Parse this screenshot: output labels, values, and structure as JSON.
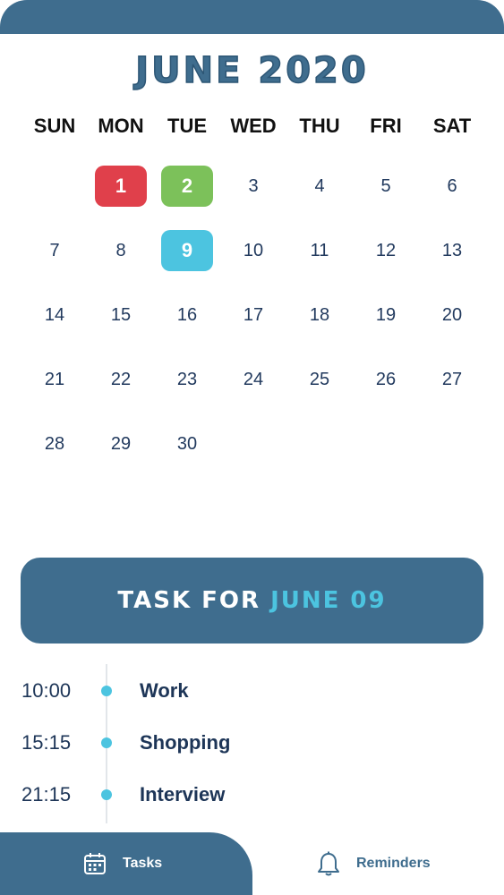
{
  "calendar": {
    "month_title": "JUNE 2020",
    "weekdays": [
      "SUN",
      "MON",
      "TUE",
      "WED",
      "THU",
      "FRI",
      "SAT"
    ],
    "days": [
      {
        "n": "1",
        "col": 1,
        "row": 0,
        "style": "red"
      },
      {
        "n": "2",
        "col": 2,
        "row": 0,
        "style": "green"
      },
      {
        "n": "3",
        "col": 3,
        "row": 0
      },
      {
        "n": "4",
        "col": 4,
        "row": 0
      },
      {
        "n": "5",
        "col": 5,
        "row": 0
      },
      {
        "n": "6",
        "col": 6,
        "row": 0
      },
      {
        "n": "7",
        "col": 0,
        "row": 1
      },
      {
        "n": "8",
        "col": 1,
        "row": 1
      },
      {
        "n": "9",
        "col": 2,
        "row": 1,
        "style": "cyan"
      },
      {
        "n": "10",
        "col": 3,
        "row": 1
      },
      {
        "n": "11",
        "col": 4,
        "row": 1
      },
      {
        "n": "12",
        "col": 5,
        "row": 1
      },
      {
        "n": "13",
        "col": 6,
        "row": 1
      },
      {
        "n": "14",
        "col": 0,
        "row": 2
      },
      {
        "n": "15",
        "col": 1,
        "row": 2
      },
      {
        "n": "16",
        "col": 2,
        "row": 2
      },
      {
        "n": "17",
        "col": 3,
        "row": 2
      },
      {
        "n": "18",
        "col": 4,
        "row": 2
      },
      {
        "n": "19",
        "col": 5,
        "row": 2
      },
      {
        "n": "20",
        "col": 6,
        "row": 2
      },
      {
        "n": "21",
        "col": 0,
        "row": 3
      },
      {
        "n": "22",
        "col": 1,
        "row": 3
      },
      {
        "n": "23",
        "col": 2,
        "row": 3
      },
      {
        "n": "24",
        "col": 3,
        "row": 3
      },
      {
        "n": "25",
        "col": 4,
        "row": 3
      },
      {
        "n": "26",
        "col": 5,
        "row": 3
      },
      {
        "n": "27",
        "col": 6,
        "row": 3
      },
      {
        "n": "28",
        "col": 0,
        "row": 4
      },
      {
        "n": "29",
        "col": 1,
        "row": 4
      },
      {
        "n": "30",
        "col": 2,
        "row": 4
      }
    ]
  },
  "task_banner": {
    "lead": "TASK FOR ",
    "date": "JUNE 09"
  },
  "tasks": [
    {
      "time": "10:00",
      "name": "Work"
    },
    {
      "time": "15:15",
      "name": "Shopping"
    },
    {
      "time": "21:15",
      "name": "Interview"
    }
  ],
  "nav": {
    "tasks_label": "Tasks",
    "tasks_icon": "calendar-icon",
    "reminders_label": "Reminders",
    "reminders_icon": "bell-icon"
  },
  "colors": {
    "primary": "#3f6d8e",
    "accent": "#4cc4e0",
    "red": "#e0404b",
    "green": "#7cc15a",
    "text": "#1d3557"
  }
}
